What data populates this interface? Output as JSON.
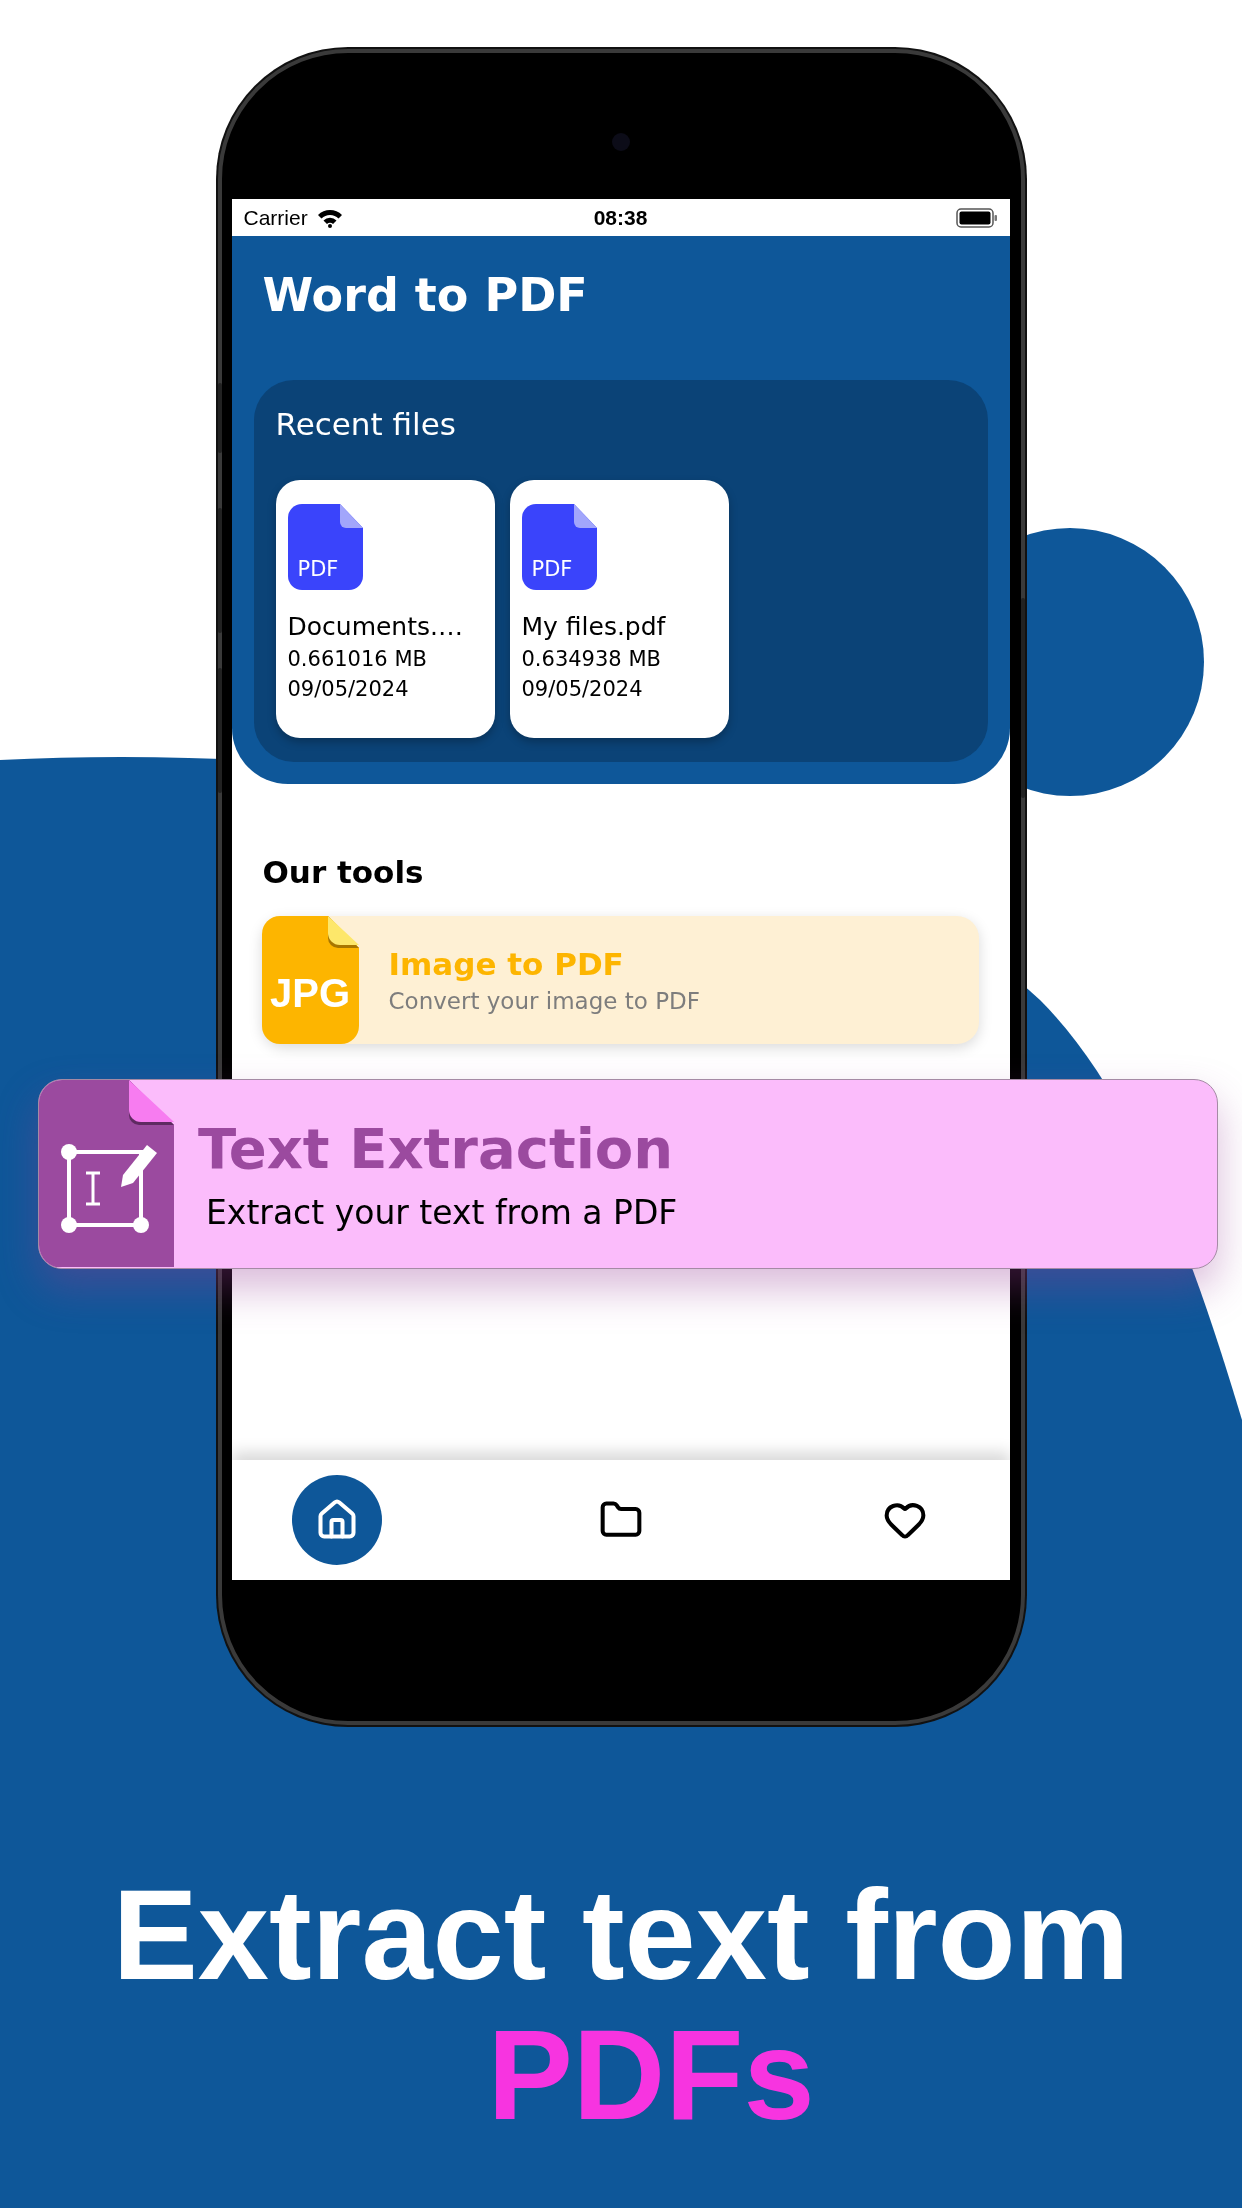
{
  "status_bar": {
    "carrier": "Carrier",
    "time": "08:38"
  },
  "header": {
    "title": "Word to PDF"
  },
  "recent_files": {
    "title": "Recent files",
    "files": [
      {
        "icon_label": "PDF",
        "name": "Documents.…",
        "size": "0.661016 MB",
        "date": "09/05/2024"
      },
      {
        "icon_label": "PDF",
        "name": "My files.pdf",
        "size": "0.634938 MB",
        "date": "09/05/2024"
      }
    ]
  },
  "tools": {
    "title": "Our tools",
    "items": [
      {
        "icon_label": "JPG",
        "title": "Image to PDF",
        "subtitle": "Convert your image to PDF"
      }
    ]
  },
  "featured_tool": {
    "title": "Text Extraction",
    "subtitle": "Extract your text from a PDF"
  },
  "bottom_nav": [
    {
      "kind": "home",
      "selected": true
    },
    {
      "kind": "files",
      "selected": false
    },
    {
      "kind": "favorites",
      "selected": false
    }
  ],
  "headline": {
    "line_1": "Extract text from",
    "line_2": "PDFs"
  }
}
